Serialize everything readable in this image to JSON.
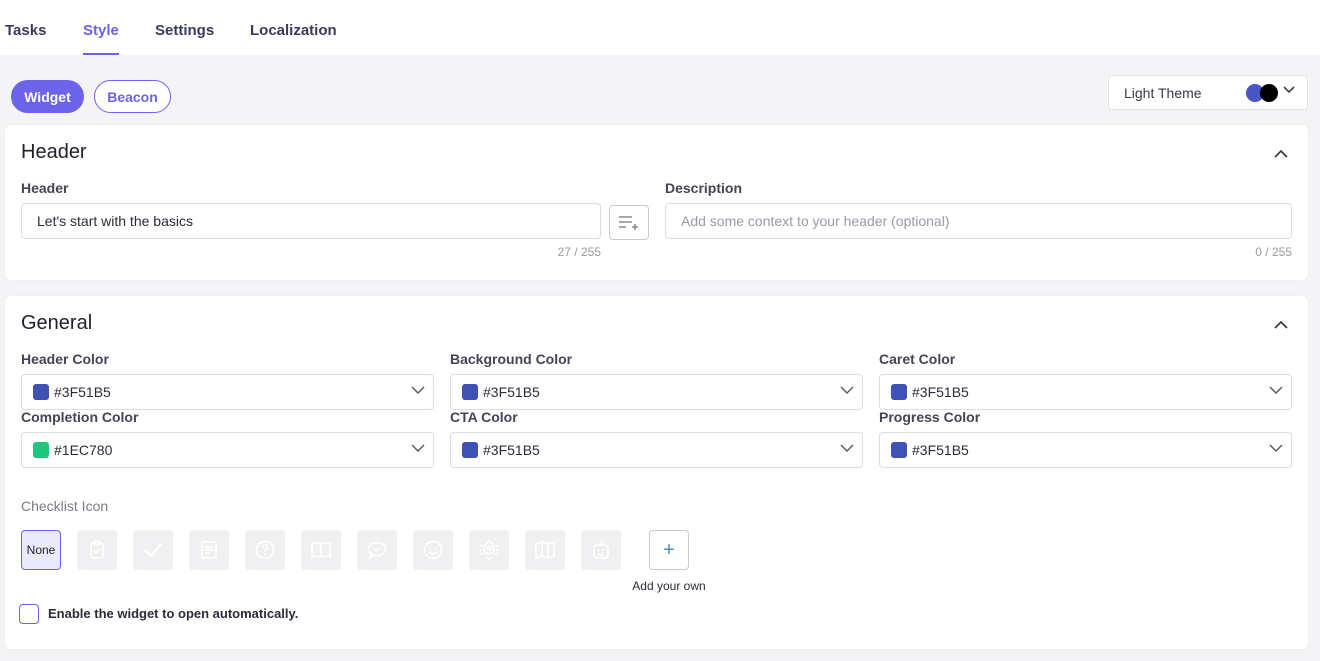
{
  "nav": {
    "tabs": [
      {
        "label": "Tasks"
      },
      {
        "label": "Style",
        "active": true
      },
      {
        "label": "Settings"
      },
      {
        "label": "Localization"
      }
    ]
  },
  "mode": {
    "widget_label": "Widget",
    "beacon_label": "Beacon",
    "active": "Widget"
  },
  "theme": {
    "selected": "Light Theme",
    "colors": [
      "#4a55c8",
      "#000000"
    ]
  },
  "header_card": {
    "title": "Header",
    "header_label": "Header",
    "header_value": "Let's start with the basics",
    "header_counter": "27 / 255",
    "description_label": "Description",
    "description_placeholder": "Add some context to your header (optional)",
    "description_counter": "0 / 255"
  },
  "general_card": {
    "title": "General",
    "colors": [
      {
        "label": "Header Color",
        "value": "#3F51B5"
      },
      {
        "label": "Background Color",
        "value": "#3F51B5"
      },
      {
        "label": "Caret Color",
        "value": "#3F51B5"
      },
      {
        "label": "Completion Color",
        "value": "#1EC780"
      },
      {
        "label": "CTA Color",
        "value": "#3F51B5"
      },
      {
        "label": "Progress Color",
        "value": "#3F51B5"
      }
    ],
    "checklist_icon_label": "Checklist Icon",
    "icon_none_label": "None",
    "icons": [
      "clipboard-check-icon",
      "checkmark-icon",
      "document-icon",
      "question-circle-icon",
      "open-book-icon",
      "chat-bubble-icon",
      "smiley-icon",
      "rocket-launch-icon",
      "map-icon",
      "robot-icon"
    ],
    "add_own_label": "Add your own",
    "auto_open_label": "Enable the widget to open automatically.",
    "auto_open_checked": false
  },
  "accent_color": "#6c63e8"
}
